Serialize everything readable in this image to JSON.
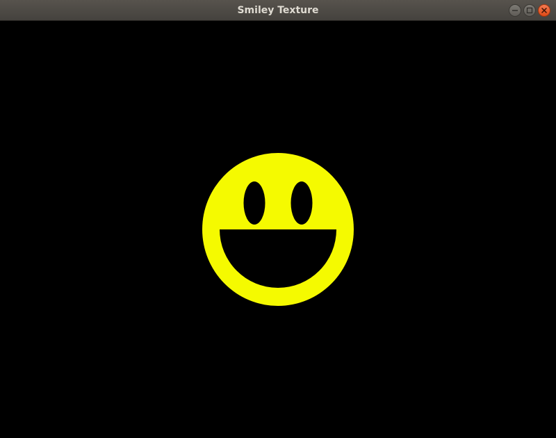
{
  "window": {
    "title": "Smiley Texture",
    "controls": [
      {
        "name": "minimize",
        "icon": "minimize-icon"
      },
      {
        "name": "maximize",
        "icon": "maximize-icon"
      },
      {
        "name": "close",
        "icon": "close-icon"
      }
    ]
  },
  "scene": {
    "background_color": "#000000",
    "face_color": "#f5fa00",
    "feature_color": "#000000",
    "image": "smiley-face"
  }
}
